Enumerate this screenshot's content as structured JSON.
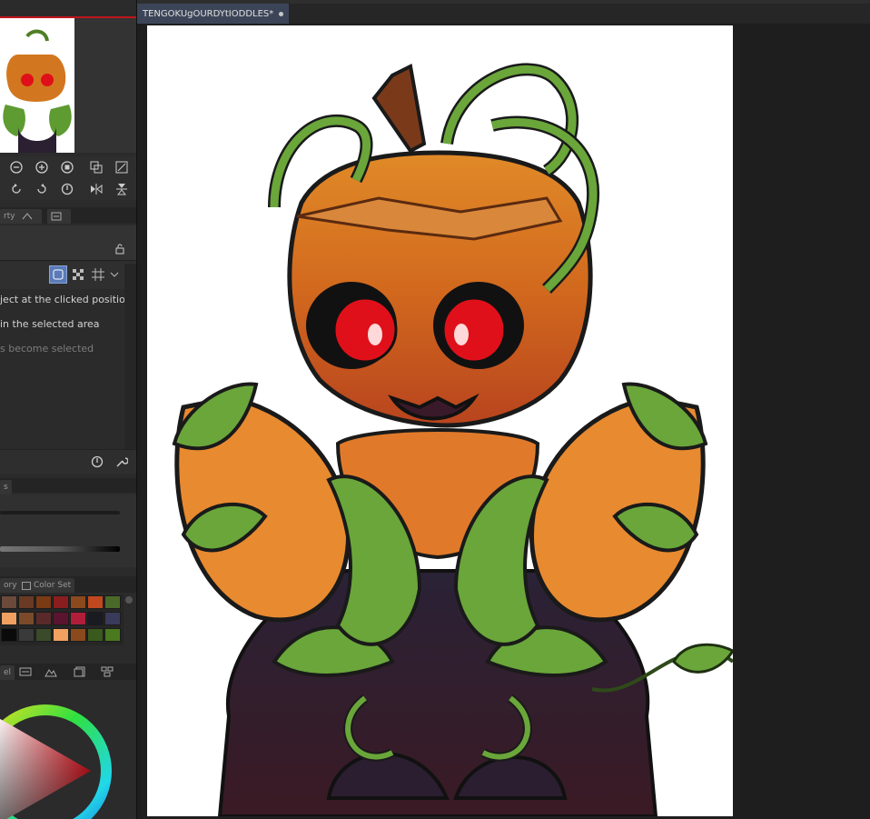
{
  "document": {
    "tab_title": "TENGOKUgOURDYtIODDLES*"
  },
  "tool_property": {
    "tabs": [
      "rty",
      "",
      ""
    ],
    "options": [
      "ject at the clicked position",
      "in the selected area",
      "s become selected"
    ]
  },
  "sub_tool_tabs": {
    "first": "s"
  },
  "color_panel": {
    "tabs": [
      "ory",
      "Color Set"
    ],
    "swatches": [
      "#6b4a3a",
      "#6a3a24",
      "#7a3a14",
      "#8a1e1e",
      "#8a4a1e",
      "#c0481e",
      "#4a6a2a",
      "#f0a060",
      "#7a4a2a",
      "#5a2a2a",
      "#5a1430",
      "#b01e3a",
      "#1a1a22",
      "#3a3a5a",
      "#0a0a0a",
      "#3a3a3a",
      "#3a4a2a",
      "#f0a060",
      "#8a4a1e",
      "#3a5a1e",
      "#4a7a1e"
    ]
  },
  "layer_tabs": {
    "first": "el"
  }
}
